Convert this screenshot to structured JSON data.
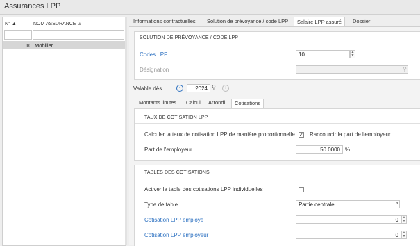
{
  "window": {
    "title": "Assurances LPP"
  },
  "list": {
    "columns": {
      "no": "N°",
      "name": "NOM ASSURANCE"
    },
    "sort_icon": "triangle-up-icon",
    "rows": [
      {
        "no": "10",
        "name": "Mobilier"
      }
    ]
  },
  "tabs": [
    {
      "label": "Informations contractuelles"
    },
    {
      "label": "Solution de prévoyance / code LPP"
    },
    {
      "label": "Salaire LPP assuré"
    },
    {
      "label": "Dossier"
    }
  ],
  "active_tab": "Salaire LPP assuré",
  "solution": {
    "title": "SOLUTION DE PRÉVOYANCE / CODE LPP",
    "codes_label": "Codes LPP",
    "codes_value": "10",
    "designation_label": "Désignation",
    "designation_value": ""
  },
  "valable": {
    "label": "Valable dès",
    "year": "2024"
  },
  "subtabs": [
    {
      "label": "Montants limites"
    },
    {
      "label": "Calcul"
    },
    {
      "label": "Arrondi"
    },
    {
      "label": "Cotisations"
    }
  ],
  "active_subtab": "Cotisations",
  "taux": {
    "title": "TAUX DE COTISATION LPP",
    "proportional_label": "Calculer la taux de cotisation LPP de manière proportionnelle",
    "proportional_checked": true,
    "shorten_label": "Raccourcir la part de l'employeur",
    "part_label": "Part de l'employeur",
    "part_value": "50.0000",
    "part_unit": "%"
  },
  "tables": {
    "title": "TABLES DES COTISATIONS",
    "activate_label": "Activer la table des cotisations LPP individuelles",
    "activate_checked": false,
    "type_label": "Type de table",
    "type_value": "Partie centrale",
    "employee_label": "Cotisation LPP employé",
    "employee_value": "0",
    "employer_label": "Cotisation LPP employeur",
    "employer_value": "0"
  },
  "colors": {
    "accent": "#2a6fc0",
    "selected_row": "#d6d6d6"
  }
}
